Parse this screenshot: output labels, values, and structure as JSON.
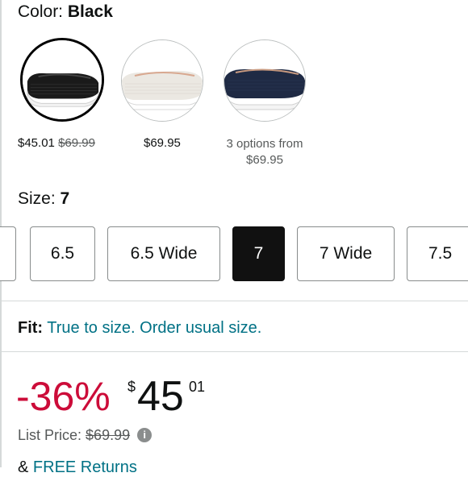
{
  "color": {
    "label": "Color:",
    "value": "Black"
  },
  "swatches": [
    {
      "name": "Black",
      "price": "$45.01",
      "list_price": "$69.99"
    },
    {
      "name": "White",
      "price": "$69.95"
    },
    {
      "name": "Navy",
      "line1": "3 options from",
      "line2": "$69.95"
    }
  ],
  "size": {
    "label": "Size:",
    "value": "7",
    "options": [
      "6.5",
      "6.5 Wide",
      "7",
      "7 Wide",
      "7.5"
    ],
    "selected": "7"
  },
  "fit": {
    "label": "Fit:",
    "text": "True to size. Order usual size."
  },
  "price": {
    "discount": "-36%",
    "symbol": "$",
    "whole": "45",
    "fraction": "01",
    "list_label": "List Price:",
    "list_value": "$69.99"
  },
  "returns": {
    "prefix": "&",
    "link": "FREE Returns"
  },
  "icons": {
    "info": "info-icon"
  },
  "colors": {
    "accent_link": "#007185",
    "discount": "#cc0c39",
    "selected_size_bg": "#111111"
  }
}
